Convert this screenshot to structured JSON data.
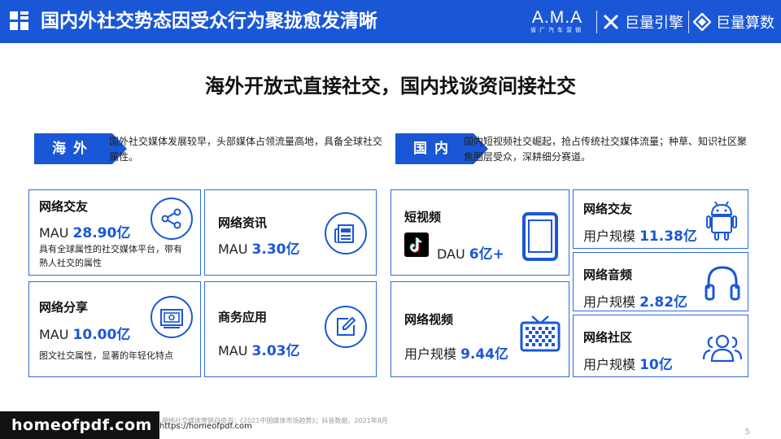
{
  "header": {
    "title": "国内外社交势态因受众行为聚拢愈发清晰",
    "ama_main": "A.M.A",
    "ama_sub": "省广汽车营销",
    "brand1": "巨量引擎",
    "brand2": "巨量算数"
  },
  "subtitle": "海外开放式直接社交，国内找谈资间接社交",
  "overseas": {
    "tag": "海外",
    "desc": "国外社交媒体发展较早，头部媒体占领流量高地，具备全球社交属性。",
    "cards": [
      {
        "title": "网络交友",
        "metric_prefix": "MAU ",
        "metric_value": "28.90亿",
        "note": "具有全球属性的社交媒体平台，带有熟人社交的属性",
        "icon": "share-icon"
      },
      {
        "title": "网络资讯",
        "metric_prefix": "MAU ",
        "metric_value": "3.30亿",
        "icon": "newspaper-icon"
      },
      {
        "title": "网络分享",
        "metric_prefix": "MAU ",
        "metric_value": "10.00亿",
        "note": "图文社交属性，显著的年轻化特点",
        "icon": "photo-icon"
      },
      {
        "title": "商务应用",
        "metric_prefix": "MAU ",
        "metric_value": "3.03亿",
        "icon": "edit-icon"
      }
    ]
  },
  "domestic": {
    "tag": "国内",
    "desc": "国内短视频社交崛起，抢占传统社交媒体流量；种草、知识社区聚焦圈层受众，深耕细分赛道。",
    "cards": [
      {
        "title": "短视频",
        "metric_prefix": "DAU ",
        "metric_value": "6亿+",
        "icon": "tablet-icon",
        "logo": "tiktok-icon"
      },
      {
        "title": "网络视频",
        "metric_prefix": "用户规模 ",
        "metric_value": "9.44亿",
        "icon": "tv-icon"
      },
      {
        "title": "网络交友",
        "metric_prefix": "用户规模 ",
        "metric_value": "11.38亿",
        "icon": "android-icon"
      },
      {
        "title": "网络音频",
        "metric_prefix": "用户规模 ",
        "metric_value": "2.82亿",
        "icon": "headphones-icon"
      },
      {
        "title": "网络社区",
        "metric_prefix": "用户规模 ",
        "metric_value": "10亿",
        "icon": "community-icon"
      }
    ]
  },
  "source": "来源：胡桃社交媒体营销白皮书；《2021中国媒体市场趋势》；抖音数据，2021年8月",
  "page_number": "5",
  "watermark": "homeofpdf.com",
  "watermark_url": "https://homeofpdf.com",
  "colors": {
    "accent": "#1a57d6",
    "border": "#2f6ae0"
  }
}
